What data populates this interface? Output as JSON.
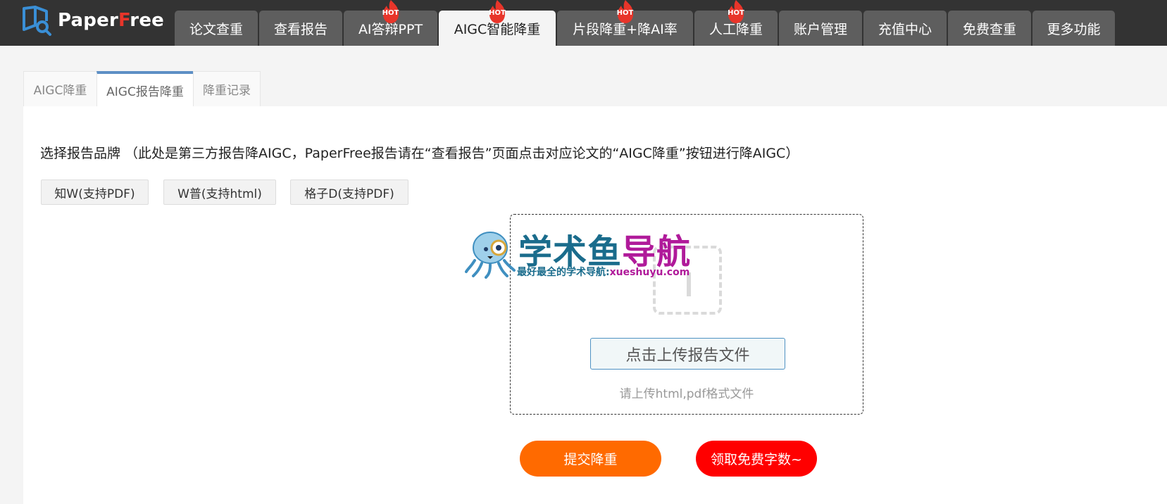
{
  "logo": {
    "text_main": "Paper",
    "text_accent": "F",
    "text_tail": "ree"
  },
  "nav": {
    "tabs": [
      {
        "label": "论文查重",
        "hot": false,
        "active": false
      },
      {
        "label": "查看报告",
        "hot": false,
        "active": false
      },
      {
        "label": "AI答辩PPT",
        "hot": true,
        "active": false
      },
      {
        "label": "AIGC智能降重",
        "hot": true,
        "active": true
      },
      {
        "label": "片段降重+降AI率",
        "hot": true,
        "active": false
      },
      {
        "label": "人工降重",
        "hot": true,
        "active": false
      },
      {
        "label": "账户管理",
        "hot": false,
        "active": false
      },
      {
        "label": "充值中心",
        "hot": false,
        "active": false
      },
      {
        "label": "免费查重",
        "hot": false,
        "active": false
      },
      {
        "label": "更多功能",
        "hot": false,
        "active": false
      }
    ],
    "hot_label": "HOT"
  },
  "subtabs": [
    {
      "label": "AIGC降重",
      "active": false
    },
    {
      "label": "AIGC报告降重",
      "active": true
    },
    {
      "label": "降重记录",
      "active": false
    }
  ],
  "main": {
    "brand_label": "选择报告品牌 （此处是第三方报告降AIGC，PaperFree报告请在“查看报告”页面点击对应论文的“AIGC降重”按钮进行降AIGC）",
    "brands": [
      "知W(支持PDF)",
      "W普(支持html)",
      "格子D(支持PDF)"
    ],
    "upload": {
      "button_label": "点击上传报告文件",
      "hint": "请上传html,pdf格式文件"
    },
    "submit_label": "提交降重",
    "free_label": "领取免费字数~"
  },
  "watermark": {
    "title_a": "学术鱼",
    "title_b": "导航",
    "sub_a": "最好最全的学术导航:",
    "sub_b": "xueshuyu.com"
  },
  "colors": {
    "topbar": "#333333",
    "active_subtab_border": "#5d8fc5",
    "submit": "#ff6a00",
    "free": "#ff0000",
    "hot_flame": "#e8352a"
  }
}
